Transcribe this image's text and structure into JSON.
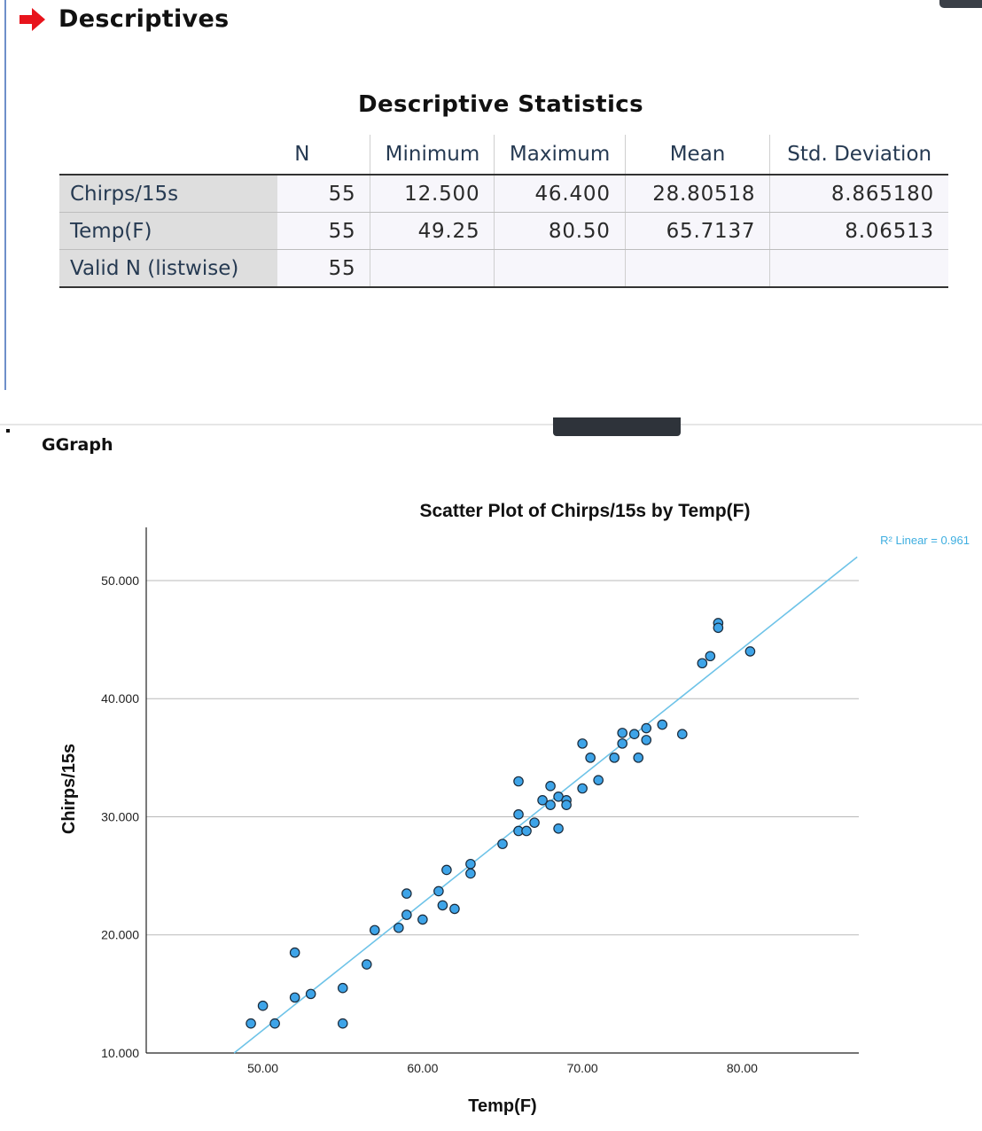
{
  "heading": {
    "title": "Descriptives",
    "icon": "red-arrow-icon",
    "icon_color": "#e8141c"
  },
  "table": {
    "title": "Descriptive Statistics",
    "columns": [
      "N",
      "Minimum",
      "Maximum",
      "Mean",
      "Std. Deviation"
    ],
    "rows": [
      {
        "label": "Chirps/15s",
        "n": "55",
        "min": "12.500",
        "max": "46.400",
        "mean": "28.80518",
        "sd": "8.865180"
      },
      {
        "label": "Temp(F)",
        "n": "55",
        "min": "49.25",
        "max": "80.50",
        "mean": "65.7137",
        "sd": "8.06513"
      },
      {
        "label": "Valid N (listwise)",
        "n": "55",
        "min": "",
        "max": "",
        "mean": "",
        "sd": ""
      }
    ]
  },
  "graph_label": "GGraph",
  "chart_data": {
    "type": "scatter",
    "title": "Scatter Plot of Chirps/15s by Temp(F)",
    "xlabel": "Temp(F)",
    "ylabel": "Chirps/15s",
    "xlim": [
      42.7,
      87.3
    ],
    "ylim": [
      10.0,
      54.5
    ],
    "xticks": [
      "50.00",
      "60.00",
      "70.00",
      "80.00"
    ],
    "xtick_values": [
      50,
      60,
      70,
      80
    ],
    "yticks": [
      "10.000",
      "20.000",
      "30.000",
      "40.000",
      "50.000"
    ],
    "ytick_values": [
      10,
      20,
      30,
      40,
      50
    ],
    "grid": "horizontal",
    "point_color": "#3ea4e8",
    "line_color": "#6ec3e8",
    "fit": {
      "label": "R² Linear = 0.961",
      "x": [
        48.2,
        87.2
      ],
      "y": [
        10.0,
        52.0
      ]
    },
    "points": [
      [
        49.25,
        12.5
      ],
      [
        50.0,
        14.0
      ],
      [
        50.75,
        12.5
      ],
      [
        52.0,
        18.5
      ],
      [
        52.0,
        14.7
      ],
      [
        53.0,
        15.0
      ],
      [
        55.0,
        15.5
      ],
      [
        55.0,
        12.5
      ],
      [
        56.5,
        17.5
      ],
      [
        57.0,
        20.4
      ],
      [
        58.5,
        20.6
      ],
      [
        59.0,
        21.7
      ],
      [
        59.0,
        23.5
      ],
      [
        60.0,
        21.3
      ],
      [
        61.0,
        23.7
      ],
      [
        61.25,
        22.5
      ],
      [
        61.5,
        25.5
      ],
      [
        62.0,
        22.2
      ],
      [
        63.0,
        26.0
      ],
      [
        63.0,
        25.2
      ],
      [
        65.0,
        27.7
      ],
      [
        66.0,
        33.0
      ],
      [
        66.0,
        30.2
      ],
      [
        66.0,
        28.8
      ],
      [
        66.5,
        28.8
      ],
      [
        67.0,
        29.5
      ],
      [
        67.5,
        31.4
      ],
      [
        68.0,
        32.6
      ],
      [
        68.0,
        31.0
      ],
      [
        68.5,
        31.7
      ],
      [
        68.5,
        29.0
      ],
      [
        69.0,
        31.4
      ],
      [
        69.0,
        31.0
      ],
      [
        70.0,
        36.2
      ],
      [
        70.0,
        32.4
      ],
      [
        70.5,
        35.0
      ],
      [
        71.0,
        33.1
      ],
      [
        72.0,
        35.0
      ],
      [
        72.5,
        37.1
      ],
      [
        72.5,
        36.2
      ],
      [
        73.25,
        37.0
      ],
      [
        73.5,
        35.0
      ],
      [
        74.0,
        37.5
      ],
      [
        74.0,
        36.5
      ],
      [
        75.0,
        37.8
      ],
      [
        76.25,
        37.0
      ],
      [
        77.5,
        43.0
      ],
      [
        78.0,
        43.6
      ],
      [
        78.5,
        46.4
      ],
      [
        78.5,
        46.0
      ],
      [
        80.5,
        44.0
      ]
    ]
  }
}
